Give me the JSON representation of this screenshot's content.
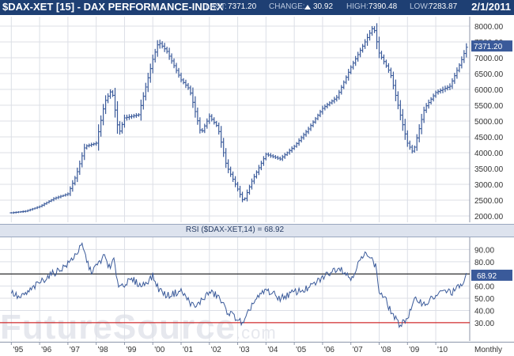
{
  "header": {
    "title": "$DAX-XET [15] - DAX PERFORMANCE-INDEX",
    "last_label": "LAST:",
    "last_value": "7371.20",
    "change_label": "CHANGE:",
    "change_value": "30.92",
    "high_label": "HIGH:",
    "high_value": "7390.48",
    "low_label": "LOW:",
    "low_value": "7283.87",
    "date": "2/1/2011"
  },
  "colors": {
    "header_bg": "#1e3f73",
    "series": "#3a5a9a",
    "rsi_upper_line": "#000000",
    "rsi_lower_line": "#cc0000",
    "price_tag_bg": "#3a5a9a"
  },
  "watermark": {
    "brand": "FutureSource",
    "suffix": ".com"
  },
  "chart_data": [
    {
      "type": "ohlc",
      "interval": "Monthly",
      "ylim": [
        1800,
        8300
      ],
      "yticks": [
        2000,
        2500,
        3000,
        3500,
        4000,
        4500,
        5000,
        5500,
        6000,
        6500,
        7000,
        7500,
        8000
      ],
      "ytick_labels": [
        "2000.00",
        "2500.00",
        "3000.00",
        "3500.00",
        "4000.00",
        "4500.00",
        "5000.00",
        "5500.00",
        "6000.00",
        "6500.00",
        "7000.00",
        "7500.00",
        "8000.00"
      ],
      "last_price_tag": "7371.20",
      "last_price": 7371.2,
      "grid": true,
      "x": [
        1995.0,
        1995.5,
        1996.0,
        1996.5,
        1997.0,
        1997.3,
        1997.6,
        1998.0,
        1998.3,
        1998.55,
        1998.8,
        1999.0,
        1999.5,
        2000.0,
        2000.2,
        2000.5,
        2001.0,
        2001.3,
        2001.7,
        2002.0,
        2002.3,
        2002.6,
        2003.0,
        2003.2,
        2003.5,
        2004.0,
        2004.5,
        2005.0,
        2005.5,
        2006.0,
        2006.5,
        2007.0,
        2007.5,
        2007.8,
        2008.0,
        2008.4,
        2008.8,
        2009.0,
        2009.2,
        2009.6,
        2010.0,
        2010.5,
        2010.9,
        2011.1
      ],
      "close": [
        2100,
        2150,
        2300,
        2550,
        2700,
        3300,
        4200,
        4300,
        5600,
        6000,
        4600,
        5100,
        5200,
        6950,
        7500,
        7200,
        6300,
        6000,
        4600,
        5150,
        4800,
        3600,
        2850,
        2450,
        3100,
        3950,
        3800,
        4200,
        4750,
        5400,
        5750,
        6700,
        7500,
        8000,
        7150,
        6500,
        5000,
        4300,
        4000,
        5400,
        5900,
        6100,
        6900,
        7371
      ]
    },
    {
      "type": "line",
      "title": "RSI ($DAX-XET,14) = 68.92",
      "ylim": [
        15,
        100
      ],
      "yticks": [
        30,
        40,
        50,
        60,
        70,
        80,
        90
      ],
      "ytick_labels": [
        "30.00",
        "40.00",
        "50.00",
        "60.00",
        "70.00",
        "80.00",
        "90.00"
      ],
      "upper_line": 70,
      "lower_line": 30,
      "last_value_tag": "68.92",
      "x": [
        1995.0,
        1995.3,
        1995.6,
        1996.0,
        1996.3,
        1996.6,
        1997.0,
        1997.3,
        1997.5,
        1997.8,
        1998.0,
        1998.3,
        1998.5,
        1998.6,
        1998.8,
        1999.0,
        1999.3,
        1999.6,
        2000.0,
        2000.2,
        2000.5,
        2001.0,
        2001.2,
        2001.5,
        2001.7,
        2002.0,
        2002.3,
        2002.6,
        2003.0,
        2003.2,
        2003.5,
        2004.0,
        2004.5,
        2005.0,
        2005.5,
        2006.0,
        2006.3,
        2006.6,
        2007.0,
        2007.3,
        2007.6,
        2007.9,
        2008.0,
        2008.2,
        2008.4,
        2008.7,
        2009.0,
        2009.3,
        2009.6,
        2010.0,
        2010.3,
        2010.6,
        2011.0,
        2011.1
      ],
      "values": [
        55,
        50,
        55,
        63,
        68,
        72,
        78,
        87,
        93,
        72,
        76,
        85,
        73,
        83,
        60,
        62,
        65,
        60,
        68,
        58,
        52,
        56,
        50,
        42,
        48,
        55,
        52,
        40,
        33,
        28,
        45,
        57,
        50,
        55,
        58,
        67,
        72,
        76,
        66,
        80,
        88,
        75,
        55,
        50,
        40,
        28,
        34,
        50,
        45,
        52,
        56,
        55,
        63,
        68.92
      ]
    }
  ],
  "x_axis": {
    "labels": [
      "'95",
      "'96",
      "'97",
      "'98",
      "'99",
      "'00",
      "'01",
      "'02",
      "'03",
      "'04",
      "'05",
      "'06",
      "'07",
      "'08",
      "'09",
      "'10"
    ],
    "interval_label": "Monthly"
  }
}
